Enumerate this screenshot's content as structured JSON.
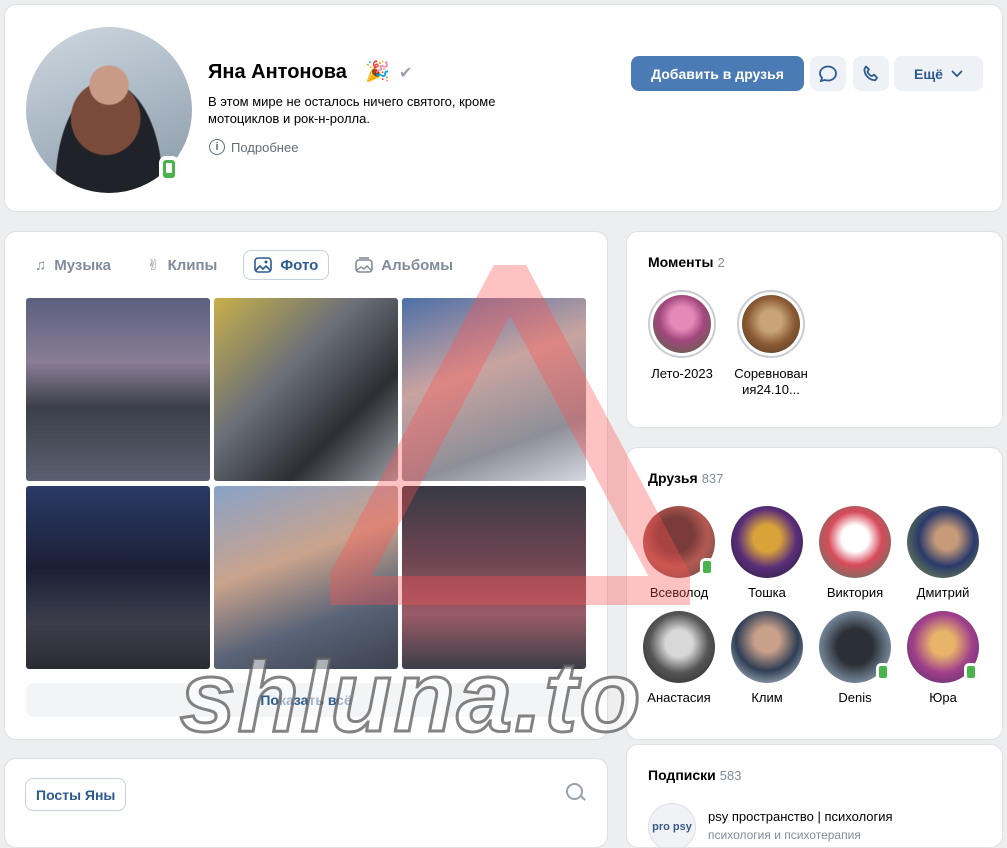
{
  "profile": {
    "name": "Яна Антонова",
    "emoji": "🎉",
    "status": "В этом мире не осталось ничего святого, кроме мотоциклов и рок-н-ролла.",
    "more_info": "Подробнее",
    "add_friend": "Добавить в друзья",
    "more": "Ещё"
  },
  "media": {
    "tabs": [
      "Музыка",
      "Клипы",
      "Фото",
      "Альбомы"
    ],
    "active_tab": "Фото",
    "show_all": "Показать всё"
  },
  "posts": {
    "tab": "Посты Яны"
  },
  "moments": {
    "title": "Моменты",
    "count": "2",
    "items": [
      {
        "label": "Лето-2023"
      },
      {
        "label": "Соревнования24.10..."
      }
    ]
  },
  "friends": {
    "title": "Друзья",
    "count": "837",
    "items": [
      {
        "name": "Всеволод",
        "online": true
      },
      {
        "name": "Тошка",
        "online": false
      },
      {
        "name": "Виктория",
        "online": false
      },
      {
        "name": "Дмитрий",
        "online": false
      },
      {
        "name": "Анастасия",
        "online": false
      },
      {
        "name": "Клим",
        "online": false
      },
      {
        "name": "Denis",
        "online": true
      },
      {
        "name": "Юра",
        "online": true
      }
    ]
  },
  "subscriptions": {
    "title": "Подписки",
    "count": "583",
    "items": [
      {
        "name": "psy пространство | психология",
        "desc": "психология и психотерапия",
        "avatar_text": "pro psy"
      }
    ]
  },
  "watermark": "shluna.to",
  "colors": {
    "accent": "#4a7bb5",
    "link": "#2d5b8f",
    "online": "#4bb34b",
    "background": "#edeef0"
  }
}
